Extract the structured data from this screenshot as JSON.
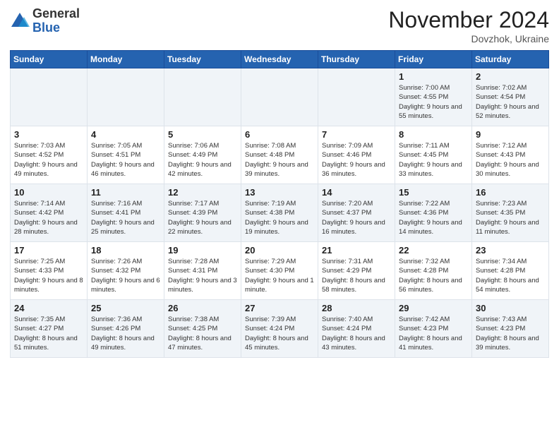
{
  "header": {
    "logo_general": "General",
    "logo_blue": "Blue",
    "month_title": "November 2024",
    "location": "Dovzhok, Ukraine"
  },
  "days_of_week": [
    "Sunday",
    "Monday",
    "Tuesday",
    "Wednesday",
    "Thursday",
    "Friday",
    "Saturday"
  ],
  "weeks": [
    [
      {
        "day": "",
        "info": ""
      },
      {
        "day": "",
        "info": ""
      },
      {
        "day": "",
        "info": ""
      },
      {
        "day": "",
        "info": ""
      },
      {
        "day": "",
        "info": ""
      },
      {
        "day": "1",
        "info": "Sunrise: 7:00 AM\nSunset: 4:55 PM\nDaylight: 9 hours and 55 minutes."
      },
      {
        "day": "2",
        "info": "Sunrise: 7:02 AM\nSunset: 4:54 PM\nDaylight: 9 hours and 52 minutes."
      }
    ],
    [
      {
        "day": "3",
        "info": "Sunrise: 7:03 AM\nSunset: 4:52 PM\nDaylight: 9 hours and 49 minutes."
      },
      {
        "day": "4",
        "info": "Sunrise: 7:05 AM\nSunset: 4:51 PM\nDaylight: 9 hours and 46 minutes."
      },
      {
        "day": "5",
        "info": "Sunrise: 7:06 AM\nSunset: 4:49 PM\nDaylight: 9 hours and 42 minutes."
      },
      {
        "day": "6",
        "info": "Sunrise: 7:08 AM\nSunset: 4:48 PM\nDaylight: 9 hours and 39 minutes."
      },
      {
        "day": "7",
        "info": "Sunrise: 7:09 AM\nSunset: 4:46 PM\nDaylight: 9 hours and 36 minutes."
      },
      {
        "day": "8",
        "info": "Sunrise: 7:11 AM\nSunset: 4:45 PM\nDaylight: 9 hours and 33 minutes."
      },
      {
        "day": "9",
        "info": "Sunrise: 7:12 AM\nSunset: 4:43 PM\nDaylight: 9 hours and 30 minutes."
      }
    ],
    [
      {
        "day": "10",
        "info": "Sunrise: 7:14 AM\nSunset: 4:42 PM\nDaylight: 9 hours and 28 minutes."
      },
      {
        "day": "11",
        "info": "Sunrise: 7:16 AM\nSunset: 4:41 PM\nDaylight: 9 hours and 25 minutes."
      },
      {
        "day": "12",
        "info": "Sunrise: 7:17 AM\nSunset: 4:39 PM\nDaylight: 9 hours and 22 minutes."
      },
      {
        "day": "13",
        "info": "Sunrise: 7:19 AM\nSunset: 4:38 PM\nDaylight: 9 hours and 19 minutes."
      },
      {
        "day": "14",
        "info": "Sunrise: 7:20 AM\nSunset: 4:37 PM\nDaylight: 9 hours and 16 minutes."
      },
      {
        "day": "15",
        "info": "Sunrise: 7:22 AM\nSunset: 4:36 PM\nDaylight: 9 hours and 14 minutes."
      },
      {
        "day": "16",
        "info": "Sunrise: 7:23 AM\nSunset: 4:35 PM\nDaylight: 9 hours and 11 minutes."
      }
    ],
    [
      {
        "day": "17",
        "info": "Sunrise: 7:25 AM\nSunset: 4:33 PM\nDaylight: 9 hours and 8 minutes."
      },
      {
        "day": "18",
        "info": "Sunrise: 7:26 AM\nSunset: 4:32 PM\nDaylight: 9 hours and 6 minutes."
      },
      {
        "day": "19",
        "info": "Sunrise: 7:28 AM\nSunset: 4:31 PM\nDaylight: 9 hours and 3 minutes."
      },
      {
        "day": "20",
        "info": "Sunrise: 7:29 AM\nSunset: 4:30 PM\nDaylight: 9 hours and 1 minute."
      },
      {
        "day": "21",
        "info": "Sunrise: 7:31 AM\nSunset: 4:29 PM\nDaylight: 8 hours and 58 minutes."
      },
      {
        "day": "22",
        "info": "Sunrise: 7:32 AM\nSunset: 4:28 PM\nDaylight: 8 hours and 56 minutes."
      },
      {
        "day": "23",
        "info": "Sunrise: 7:34 AM\nSunset: 4:28 PM\nDaylight: 8 hours and 54 minutes."
      }
    ],
    [
      {
        "day": "24",
        "info": "Sunrise: 7:35 AM\nSunset: 4:27 PM\nDaylight: 8 hours and 51 minutes."
      },
      {
        "day": "25",
        "info": "Sunrise: 7:36 AM\nSunset: 4:26 PM\nDaylight: 8 hours and 49 minutes."
      },
      {
        "day": "26",
        "info": "Sunrise: 7:38 AM\nSunset: 4:25 PM\nDaylight: 8 hours and 47 minutes."
      },
      {
        "day": "27",
        "info": "Sunrise: 7:39 AM\nSunset: 4:24 PM\nDaylight: 8 hours and 45 minutes."
      },
      {
        "day": "28",
        "info": "Sunrise: 7:40 AM\nSunset: 4:24 PM\nDaylight: 8 hours and 43 minutes."
      },
      {
        "day": "29",
        "info": "Sunrise: 7:42 AM\nSunset: 4:23 PM\nDaylight: 8 hours and 41 minutes."
      },
      {
        "day": "30",
        "info": "Sunrise: 7:43 AM\nSunset: 4:23 PM\nDaylight: 8 hours and 39 minutes."
      }
    ]
  ]
}
